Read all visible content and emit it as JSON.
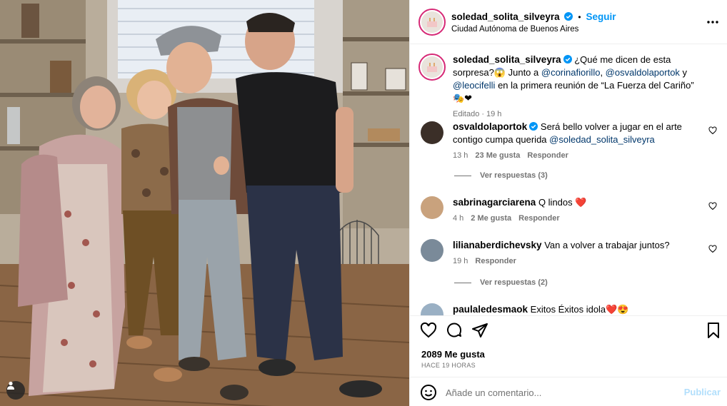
{
  "header": {
    "username": "soledad_solita_silveyra",
    "separator": "•",
    "follow_label": "Seguir",
    "location": "Ciudad Autónoma de Buenos Aires"
  },
  "caption": {
    "username": "soledad_solita_silveyra",
    "text_start": "¿Qué me dicen de esta sorpresa?😱 Junto a ",
    "mention1": "@corinafiorillo",
    "sep1": ", ",
    "mention2": "@osvaldolaportok",
    "sep2": " y ",
    "mention3": "@leocifelli",
    "text_end": " en la primera reunión de “La Fuerza del Cariño” 🎭❤",
    "edited": "Editado",
    "dot": "·",
    "time": "19 h"
  },
  "comments": [
    {
      "username": "osvaldolaportok",
      "text": "Será bello volver a jugar en el arte contigo cumpa querida ",
      "mention": "@soledad_solita_silveyra",
      "time": "13 h",
      "likes": "23 Me gusta",
      "reply": "Responder",
      "view_replies": "Ver respuestas (3)"
    },
    {
      "username": "sabrinagarciarena",
      "text": "Q lindos ❤️",
      "time": "4 h",
      "likes": "2 Me gusta",
      "reply": "Responder"
    },
    {
      "username": "lilianaberdichevsky",
      "text": "Van a volver a trabajar juntos?",
      "time": "19 h",
      "reply": "Responder",
      "view_replies": "Ver respuestas (2)"
    },
    {
      "username": "paulaledesmaok",
      "text": "Exitos Éxitos idola❤️😍"
    }
  ],
  "actions": {
    "likes": "2089 Me gusta",
    "posted": "HACE 19 HORAS"
  },
  "compose": {
    "placeholder": "Añade un comentario...",
    "publish_label": "Publicar"
  },
  "colors": {
    "link": "#00376b",
    "follow": "#0095f6",
    "verified": "#0095f6",
    "heart_red": "#ed4956",
    "secondary": "#737373",
    "publish_disabled": "#b2dffc"
  }
}
